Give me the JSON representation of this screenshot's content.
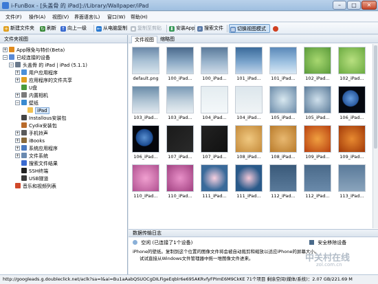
{
  "window": {
    "title": "i-FunBox - [头盖骨 的 iPad]://Library/Wallpaper/iPad",
    "minimize": "–",
    "maximize": "□",
    "close": "✕"
  },
  "menu": [
    "文件(F)",
    "操作(A)",
    "视图(V)",
    "界面语言(L)",
    "窗口(W)",
    "帮助(H)"
  ],
  "toolbar": {
    "new_folder": "新建文件夹",
    "refresh": "刷新",
    "up": "向上一级",
    "copy_from_pc": "从电脑复制",
    "copy_to_clipboard": "复制至剪贴",
    "install_app": "安装App",
    "search_file": "搜索文件",
    "switch_view": "切换视图模式"
  },
  "folder_panel": {
    "header": "文件夹视图",
    "items": [
      {
        "label": "App限免与特价(Beta)",
        "exp": "+",
        "level": 0,
        "color": "#e08a1e"
      },
      {
        "label": "已经连接的设备",
        "exp": "−",
        "level": 0,
        "color": "#5a8ad6"
      },
      {
        "label": "头盖骨 的 iPad | iPad (5.1.1)",
        "exp": "−",
        "level": 1,
        "color": "#6b7a8c"
      },
      {
        "label": "用户应用程序",
        "exp": "+",
        "level": 2,
        "color": "#4a90d9"
      },
      {
        "label": "应用程序的文件共享",
        "exp": "+",
        "level": 2,
        "color": "#e0a020"
      },
      {
        "label": "U盘",
        "exp": "",
        "level": 2,
        "color": "#4a9a3a"
      },
      {
        "label": "内置相机",
        "exp": "+",
        "level": 2,
        "color": "#7a7a7a"
      },
      {
        "label": "壁纸",
        "exp": "−",
        "level": 2,
        "color": "#3a8ad0"
      },
      {
        "label": "iPad",
        "exp": "",
        "level": 3,
        "color": "#f0c050",
        "selected": true
      },
      {
        "label": "Installous安装包",
        "exp": "",
        "level": 2,
        "color": "#444444"
      },
      {
        "label": "Cydia安装包",
        "exp": "",
        "level": 2,
        "color": "#b86a2a"
      },
      {
        "label": "手机铃声",
        "exp": "+",
        "level": 2,
        "color": "#5a5a5a"
      },
      {
        "label": "iBooks",
        "exp": "+",
        "level": 2,
        "color": "#8a6a3a"
      },
      {
        "label": "系统应用程序",
        "exp": "+",
        "level": 2,
        "color": "#4a7ac0"
      },
      {
        "label": "文件系统",
        "exp": "+",
        "level": 2,
        "color": "#6a8ab0"
      },
      {
        "label": "搜索文件结果",
        "exp": "",
        "level": 2,
        "color": "#3a6ad0"
      },
      {
        "label": "SSH终端",
        "exp": "",
        "level": 2,
        "color": "#222222"
      },
      {
        "label": "USB隧道",
        "exp": "",
        "level": 2,
        "color": "#3a3a3a"
      },
      {
        "label": "音乐和视频列表",
        "exp": "",
        "level": 1,
        "color": "#d0482a"
      }
    ]
  },
  "tabs": [
    "文件视图",
    "缩略图"
  ],
  "thumbnails": [
    {
      "name": "default.png",
      "color": "linear-gradient(#6a88a8,#a8c0d4 50%,#d8e4ec)"
    },
    {
      "name": "100_iPad...",
      "color": "linear-gradient(#4a6a8c,#8aa8c4 55%,#c8d8e4)"
    },
    {
      "name": "100_iPad...",
      "color": "linear-gradient(#5a7a9a,#9ab4cc 55%,#d0dce8)"
    },
    {
      "name": "101_iPad...",
      "color": "linear-gradient(#3a6a9a,#7aa4cc 55%,#c0d4e8)"
    },
    {
      "name": "101_iPad...",
      "color": "linear-gradient(#5a88b8,#9cc0e0 55%,#d8e8f4)"
    },
    {
      "name": "102_iPad...",
      "color": "radial-gradient(#a8d870,#5a9a3a)"
    },
    {
      "name": "102_iPad...",
      "color": "radial-gradient(#b8e080,#6aaa40)"
    },
    {
      "name": "103_iPad...",
      "color": "linear-gradient(#6a8ca8,#b0c4d4 55%,#e0e8ee)"
    },
    {
      "name": "103_iPad...",
      "color": "linear-gradient(#7a9ab6,#c0d0dc 55%,#e8eef2)"
    },
    {
      "name": "104_iPad...",
      "color": "linear-gradient(#e4ecf0,#f4f8fa)"
    },
    {
      "name": "104_iPad...",
      "color": "linear-gradient(#dce6ec,#f0f4f6)"
    },
    {
      "name": "105_iPad...",
      "color": "radial-gradient(#d8e8f0,#6a8aa8)"
    },
    {
      "name": "105_iPad...",
      "color": "radial-gradient(#cfe0ec,#5a7a98)"
    },
    {
      "name": "106_iPad...",
      "color": "radial-gradient(circle at 45% 45%,#6aa0e0 0,#2a5aa0 38%,#050810 42%)"
    },
    {
      "name": "106_iPad...",
      "color": "radial-gradient(circle at 45% 45%,#5a90d0 0,#1a4a90 40%,#04060c 44%)"
    },
    {
      "name": "107_iPad...",
      "color": "linear-gradient(135deg,#1a1a1a,#2a2a2a)"
    },
    {
      "name": "107_iPad...",
      "color": "linear-gradient(135deg,#222,#111)"
    },
    {
      "name": "108_iPad...",
      "color": "radial-gradient(#f0c880,#c48a3a)"
    },
    {
      "name": "108_iPad...",
      "color": "radial-gradient(#e8b870,#b87a2a)"
    },
    {
      "name": "109_iPad...",
      "color": "radial-gradient(#f0a040,#b84010)"
    },
    {
      "name": "109_iPad...",
      "color": "radial-gradient(#e88a30,#a03808)"
    },
    {
      "name": "110_iPad...",
      "color": "radial-gradient(#f0a0d0,#b05090)"
    },
    {
      "name": "110_iPad...",
      "color": "radial-gradient(#e890c8,#a04080)"
    },
    {
      "name": "111_iPad...",
      "color": "radial-gradient(#f8d0e0,#3a6a9a 65%)"
    },
    {
      "name": "111_iPad...",
      "color": "radial-gradient(#f4c8d8,#2a5a8a 65%)"
    },
    {
      "name": "112_iPad...",
      "color": "linear-gradient(#3a5a7a,#5a7a9a)"
    },
    {
      "name": "112_iPad...",
      "color": "linear-gradient(#4a6a8a,#6a8aaa)"
    },
    {
      "name": "113_iPad...",
      "color": "linear-gradient(#5a7a9a,#8aa4bc)"
    }
  ],
  "log": {
    "header": "数据传输日志",
    "idle": "空闲 (已连接了1个设备)",
    "safe_remove": "安全移除设备",
    "message_1": "iPhone的壁纸。复制到这个位置的图像文件将会被自动裁剪和缩放以适应iPhone的屏幕大小。",
    "message_2": "试试直接从Windows文件管理器中拖一堆图像文件进来。"
  },
  "status": {
    "left": "http://googleads.g.doubleclick.net/aclk?sa=l&ai=Bu1aAabQSUOCgDILFigeEqblr6e695AKRvfyFPImE6M9CkKE  71个项目 剩余空间(媒体/系统)：2.07 GB/221.69 M",
    "right": ""
  },
  "watermark": {
    "main": "中关村在线",
    "sub": "zol.com.cn"
  }
}
